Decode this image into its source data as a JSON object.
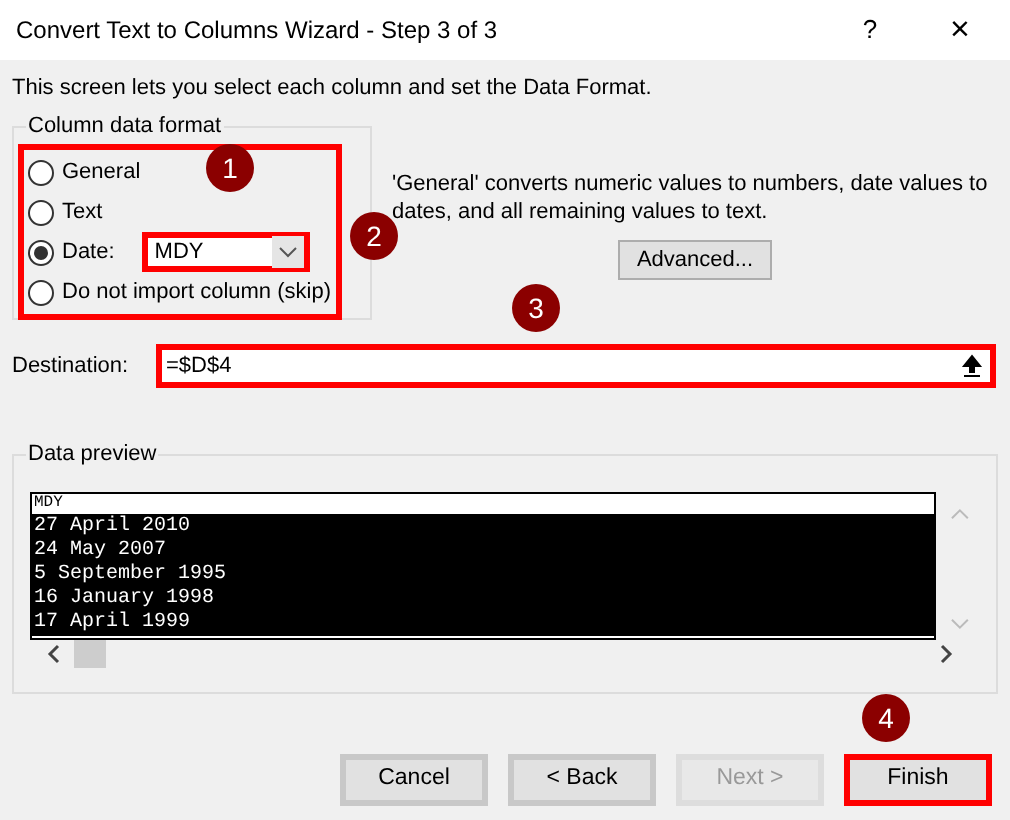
{
  "window": {
    "title": "Convert Text to Columns Wizard - Step 3 of 3",
    "help": "?",
    "close": "×"
  },
  "intro": "This screen lets you select each column and set the Data Format.",
  "column_format": {
    "label": "Column data format",
    "highlighted": true,
    "callout": "1",
    "options": [
      {
        "kind": "radio",
        "label": "General",
        "selected": false
      },
      {
        "kind": "radio",
        "label": "Text",
        "selected": false
      },
      {
        "kind": "date",
        "label": "Date:",
        "selected": true
      },
      {
        "kind": "radio",
        "label": "Do not import column (skip)",
        "selected": false
      }
    ],
    "date_combo": {
      "value": "MDY",
      "highlighted": true,
      "callout": "2"
    }
  },
  "description": "'General' converts numeric values to numbers, date values to dates, and all remaining values to text.",
  "advanced_button": "Advanced...",
  "destination": {
    "label": "Destination:",
    "value": "=$D$4",
    "highlighted": true,
    "callout": "3"
  },
  "preview": {
    "label": "Data preview",
    "columns": [
      {
        "header": "MDY",
        "selected": true,
        "rows": [
          "27 April 2010",
          "24 May 2007",
          "5 September 1995",
          "16 January 1998",
          "17 April 1999"
        ]
      }
    ]
  },
  "buttons": [
    {
      "label": "Cancel",
      "disabled": false,
      "highlighted": false
    },
    {
      "label": "< Back",
      "disabled": false,
      "highlighted": false
    },
    {
      "label": "Next >",
      "disabled": true,
      "highlighted": false
    },
    {
      "label": "Finish",
      "disabled": false,
      "highlighted": true,
      "callout": "4"
    }
  ]
}
